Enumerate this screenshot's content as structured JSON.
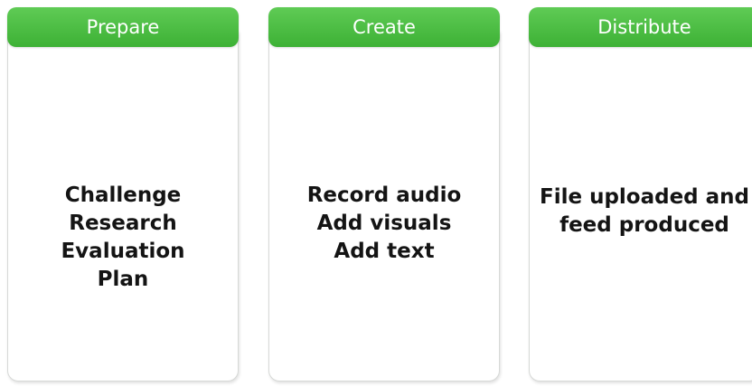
{
  "columns": [
    {
      "title": "Prepare",
      "lines": [
        "Challenge",
        "Research",
        "Evaluation",
        "Plan"
      ]
    },
    {
      "title": "Create",
      "lines": [
        "Record audio",
        "Add visuals",
        "Add text"
      ]
    },
    {
      "title": "Distribute",
      "lines": [
        "File uploaded and",
        "feed produced"
      ]
    }
  ],
  "colors": {
    "header_green": "#48bc40",
    "card_border": "#d7d9d7",
    "text": "#141414"
  }
}
